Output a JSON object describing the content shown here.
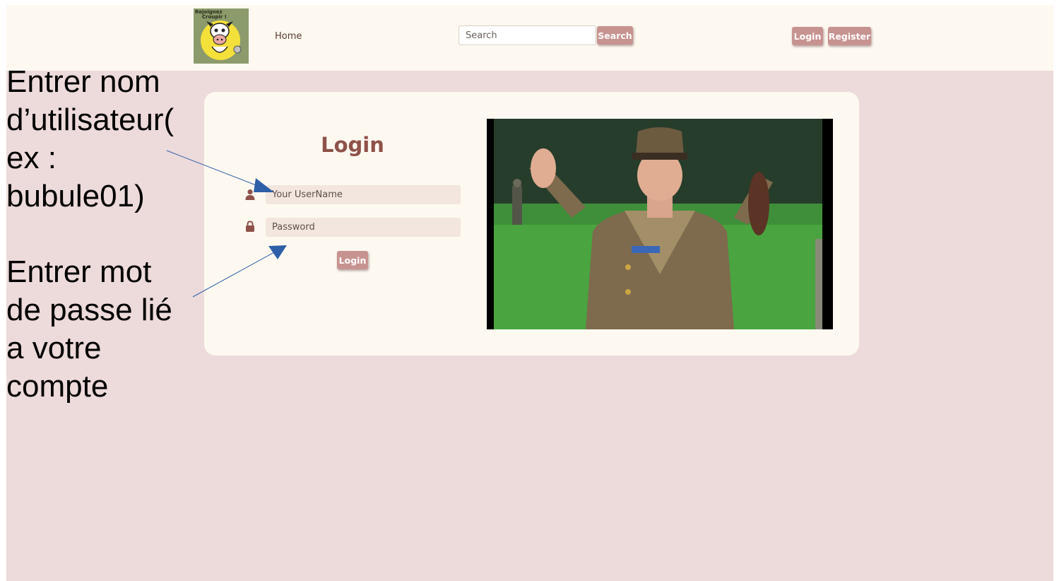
{
  "navbar": {
    "logo_text_line1": "Rejoignez",
    "logo_text_line2": "Croupir !",
    "home_label": "Home",
    "search_placeholder": "Search",
    "search_button": "Search",
    "login_button": "Login",
    "register_button": "Register"
  },
  "login_form": {
    "title": "Login",
    "username_placeholder": "Your UserName",
    "password_placeholder": "Password",
    "submit_button": "Login",
    "user_icon": "user-icon",
    "lock_icon": "lock-icon"
  },
  "annotations": {
    "username_instruction_lines": [
      "Entrer nom",
      "d’utilisateur(",
      "ex :",
      "bubule01)"
    ],
    "password_instruction_lines": [
      "Entrer mot",
      "de passe lié",
      "a votre",
      "compte"
    ]
  },
  "colors": {
    "page_background": "#eddada",
    "navbar_background": "#fdf9f1",
    "button_background": "#c79390",
    "title_color": "#8e5249",
    "arrow_color": "#2e5fa8"
  }
}
